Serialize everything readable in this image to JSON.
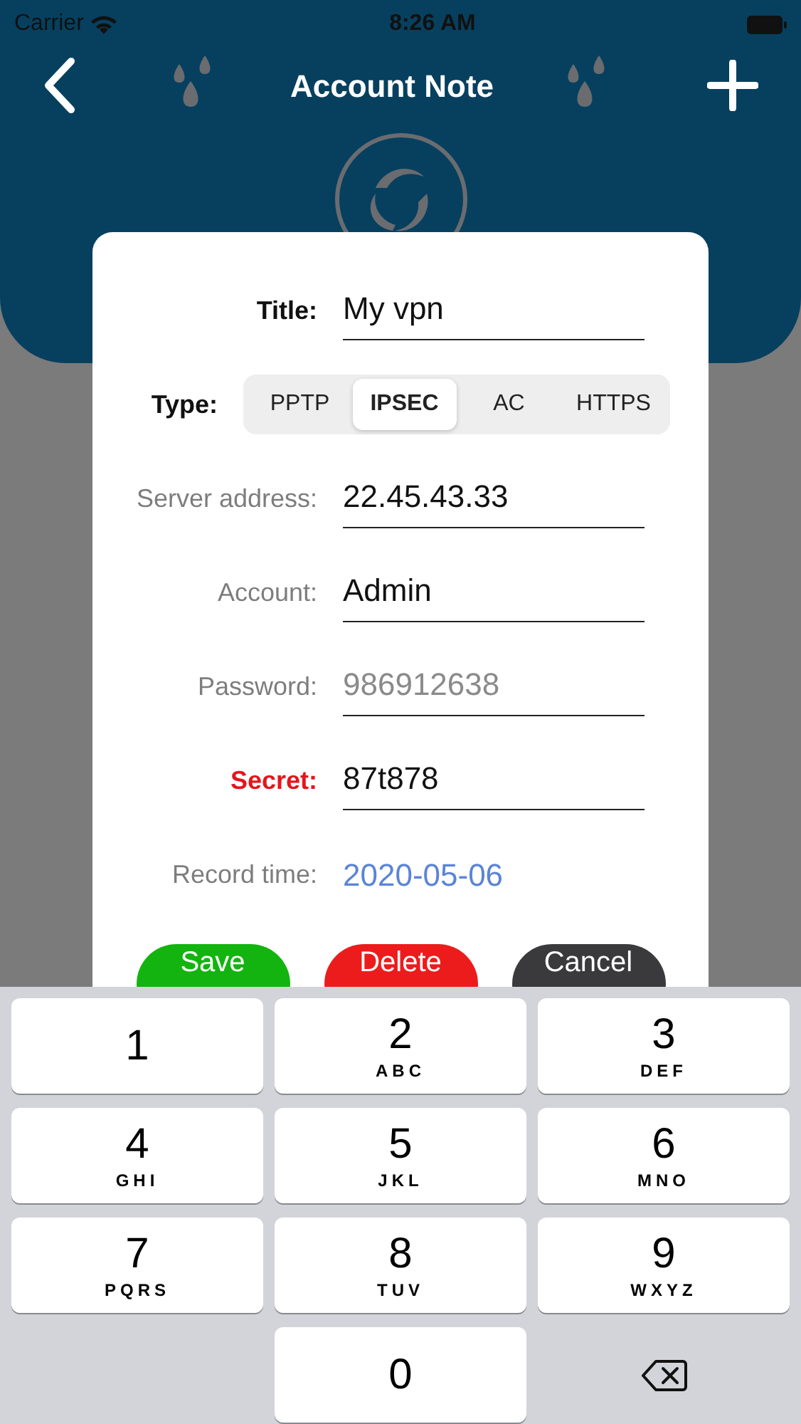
{
  "status_bar": {
    "carrier": "Carrier",
    "time": "8:26 AM"
  },
  "header": {
    "title": "Account Note"
  },
  "dialog": {
    "fields": [
      {
        "kind": "text",
        "label": "Title:",
        "value": "My vpn",
        "color": "#111111",
        "bold": true
      },
      {
        "kind": "segments",
        "label": "Type:",
        "color": "#111111",
        "bold": true,
        "options": [
          {
            "label": "PPTP",
            "selected": false
          },
          {
            "label": "IPSEC",
            "selected": true
          },
          {
            "label": "AC",
            "selected": false
          },
          {
            "label": "HTTPS",
            "selected": false
          }
        ]
      },
      {
        "kind": "text",
        "label": "Server address:",
        "value": "22.45.43.33",
        "color": "#7d7d7d",
        "bold": false
      },
      {
        "kind": "text",
        "label": "Account:",
        "value": "Admin",
        "color": "#7d7d7d",
        "bold": false
      },
      {
        "kind": "text",
        "label": "Password:",
        "placeholder": "986912638",
        "color": "#7d7d7d",
        "bold": false
      },
      {
        "kind": "text",
        "label": "Secret:",
        "value": "87t878",
        "color": "#e6151b",
        "bold": true
      },
      {
        "kind": "date",
        "label": "Record time:",
        "value": "2020-05-06",
        "color": "#7d7d7d",
        "bold": false
      }
    ],
    "buttons": [
      {
        "label": "Save",
        "color": "#13b40f"
      },
      {
        "label": "Delete",
        "color": "#ec1c1c"
      },
      {
        "label": "Cancel",
        "color": "#3a3a3c"
      }
    ]
  },
  "keyboard": {
    "keys": [
      {
        "kind": "digit",
        "digit": "1"
      },
      {
        "kind": "digit",
        "digit": "2",
        "letters": "ABC"
      },
      {
        "kind": "digit",
        "digit": "3",
        "letters": "DEF"
      },
      {
        "kind": "digit",
        "digit": "4",
        "letters": "GHI"
      },
      {
        "kind": "digit",
        "digit": "5",
        "letters": "JKL"
      },
      {
        "kind": "digit",
        "digit": "6",
        "letters": "MNO"
      },
      {
        "kind": "digit",
        "digit": "7",
        "letters": "PQRS"
      },
      {
        "kind": "digit",
        "digit": "8",
        "letters": "TUV"
      },
      {
        "kind": "digit",
        "digit": "9",
        "letters": "WXYZ"
      },
      {
        "kind": "blank"
      },
      {
        "kind": "digit",
        "digit": "0"
      },
      {
        "kind": "delete"
      }
    ]
  }
}
